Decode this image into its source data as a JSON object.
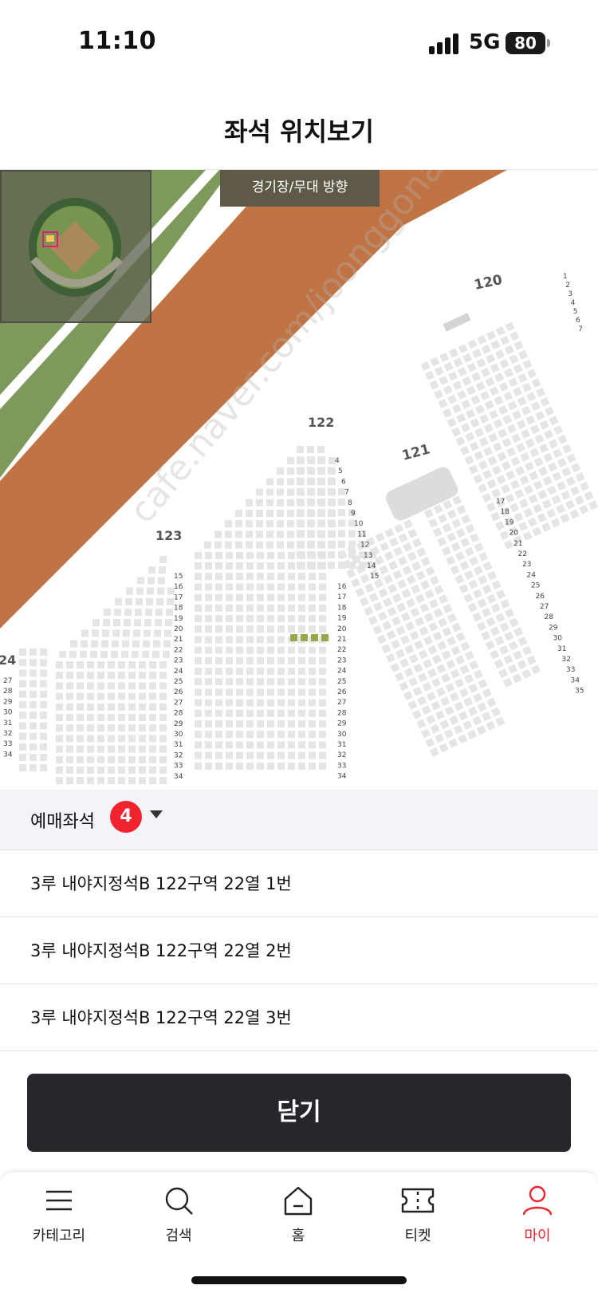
{
  "status_bar": {
    "time": "11:10",
    "network": "5G",
    "battery": "80"
  },
  "header": {
    "title": "좌석 위치보기"
  },
  "map": {
    "direction_label": "경기장/무대 방향",
    "watermark": "cafe.naver.com/joonggonara",
    "sections": [
      "120",
      "121",
      "122",
      "123",
      "24"
    ],
    "rows_122_left": [
      "15",
      "16",
      "17",
      "18",
      "19",
      "20",
      "21",
      "22",
      "23",
      "24",
      "25",
      "26",
      "27",
      "28",
      "29",
      "30",
      "31",
      "32",
      "33",
      "34"
    ],
    "rows_122_right_top": [
      "4",
      "5",
      "6",
      "7",
      "8",
      "9",
      "10",
      "11",
      "12",
      "13",
      "14",
      "15"
    ],
    "rows_122_right": [
      "16",
      "17",
      "18",
      "19",
      "20",
      "21",
      "22",
      "23",
      "24",
      "25",
      "26",
      "27",
      "28",
      "29",
      "30",
      "31",
      "32",
      "33",
      "34"
    ],
    "rows_121": [
      "17",
      "18",
      "19",
      "20",
      "21",
      "22",
      "23",
      "24",
      "25",
      "26",
      "27",
      "28",
      "29",
      "30",
      "31",
      "32",
      "33",
      "34",
      "35"
    ],
    "rows_120": [
      "1",
      "2",
      "3",
      "4",
      "5",
      "6",
      "7"
    ],
    "rows_24": [
      "27",
      "28",
      "29",
      "30",
      "31",
      "32",
      "33",
      "34"
    ],
    "colors": {
      "field": "#7d9a5c",
      "track": "#c07443",
      "seat": "#e5e5e5",
      "selected": "#97a84a"
    }
  },
  "reserved": {
    "label": "예매좌석",
    "count": "4"
  },
  "seats": [
    "3루 내야지정석B 122구역 22열 1번",
    "3루 내야지정석B 122구역 22열 2번",
    "3루 내야지정석B 122구역 22열 3번"
  ],
  "close_button": "닫기",
  "tabs": [
    {
      "label": "카테고리",
      "icon": "menu-icon"
    },
    {
      "label": "검색",
      "icon": "search-icon"
    },
    {
      "label": "홈",
      "icon": "home-icon"
    },
    {
      "label": "티켓",
      "icon": "ticket-icon"
    },
    {
      "label": "마이",
      "icon": "person-icon"
    }
  ],
  "accent_color": "#f0232f"
}
